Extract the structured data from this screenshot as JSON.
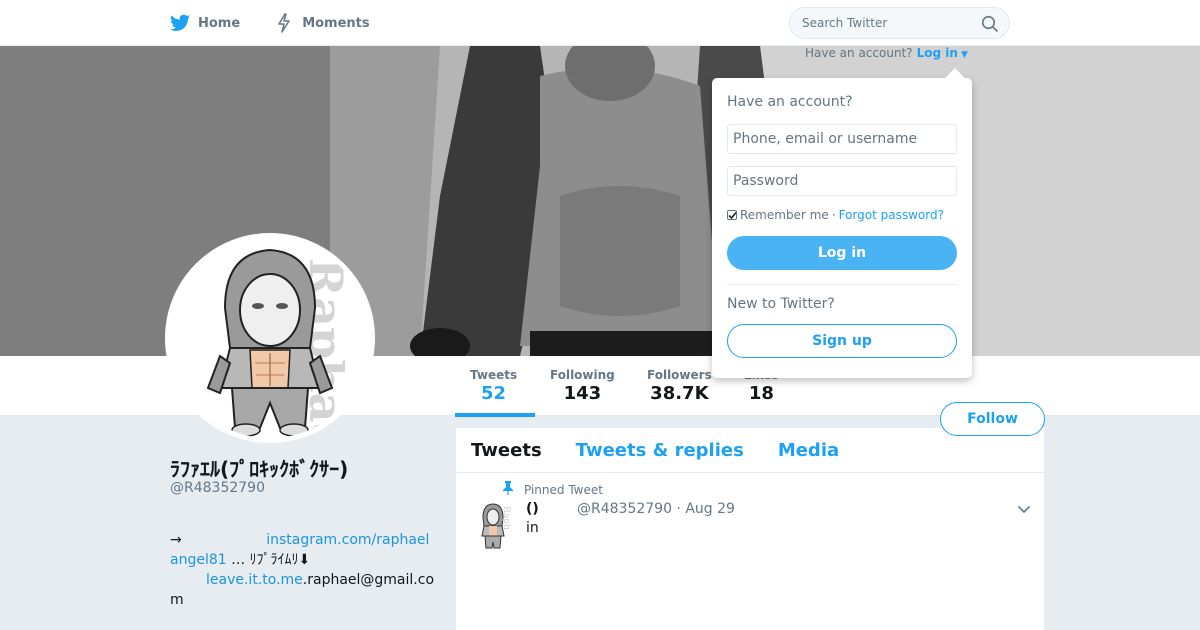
{
  "nav": {
    "home_label": "Home",
    "moments_label": "Moments",
    "search_placeholder": "Search Twitter"
  },
  "header_prompt": {
    "question": "Have an account?",
    "login_label": "Log in"
  },
  "login_dropdown": {
    "title": "Have an account?",
    "username_placeholder": "Phone, email or username",
    "password_placeholder": "Password",
    "remember_label": "Remember me",
    "separator": "·",
    "forgot_label": "Forgot password?",
    "login_button": "Log in",
    "new_label": "New to Twitter?",
    "signup_button": "Sign up"
  },
  "profile": {
    "name": "ﾗﾌｧｴﾙ(ﾌﾟﾛｷｯｸﾎﾞｸｻｰ)",
    "handle": "@R48352790",
    "bio": {
      "arrow": "→",
      "link1": "instagram.com/raphaelangel81",
      "middle": "… ﾘﾌﾟﾗｲﾑﾘ⬇",
      "link2": "leave.it.to.me",
      "email": ".raphael@gmail.com"
    }
  },
  "stats": [
    {
      "label": "Tweets",
      "value": "52"
    },
    {
      "label": "Following",
      "value": "143"
    },
    {
      "label": "Followers",
      "value": "38.7K"
    },
    {
      "label": "Likes",
      "value": "18"
    }
  ],
  "follow_button": "Follow",
  "timeline": {
    "tabs": [
      "Tweets",
      "Tweets & replies",
      "Media"
    ],
    "pinned_label": "Pinned Tweet",
    "tweet": {
      "name": "()",
      "meta": "@R48352790 · Aug 29",
      "text": "in"
    }
  },
  "colors": {
    "accent": "#1da1f2",
    "button_fill": "#4ab3f4",
    "background": "#e6ecf0"
  }
}
